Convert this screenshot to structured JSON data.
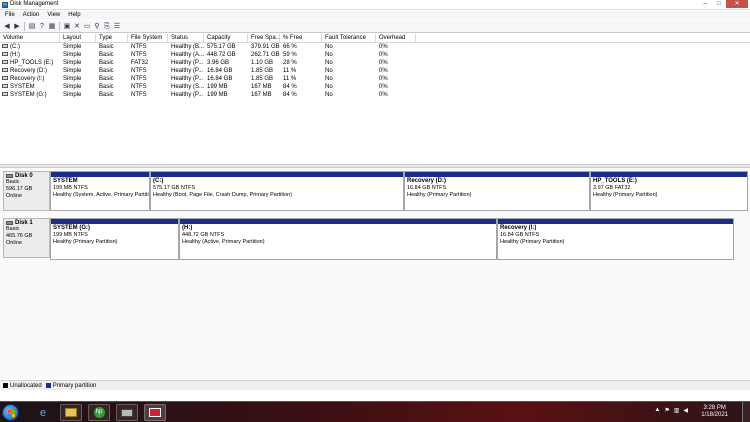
{
  "window": {
    "title": "Disk Management"
  },
  "menu": [
    "File",
    "Action",
    "View",
    "Help"
  ],
  "window_buttons": {
    "minimize": "–",
    "maximize": "□",
    "close": "✕"
  },
  "volume_columns": [
    "Volume",
    "Layout",
    "Type",
    "File System",
    "Status",
    "Capacity",
    "Free Spa...",
    "% Free",
    "Fault Tolerance",
    "Overhead"
  ],
  "volumes": [
    [
      "(C:)",
      "Simple",
      "Basic",
      "NTFS",
      "Healthy (B...",
      "575.17 GB",
      "379.91 GB",
      "66 %",
      "No",
      "0%"
    ],
    [
      "(H:)",
      "Simple",
      "Basic",
      "NTFS",
      "Healthy (A...",
      "448.72 GB",
      "262.71 GB",
      "59 %",
      "No",
      "0%"
    ],
    [
      "HP_TOOLS (E:)",
      "Simple",
      "Basic",
      "FAT32",
      "Healthy (P...",
      "3.96 GB",
      "1.10 GB",
      "28 %",
      "No",
      "0%"
    ],
    [
      "Recovery (D:)",
      "Simple",
      "Basic",
      "NTFS",
      "Healthy (P...",
      "16.84 GB",
      "1.85 GB",
      "11 %",
      "No",
      "0%"
    ],
    [
      "Recovery (I:)",
      "Simple",
      "Basic",
      "NTFS",
      "Healthy (P...",
      "16.84 GB",
      "1.85 GB",
      "11 %",
      "No",
      "0%"
    ],
    [
      "SYSTEM",
      "Simple",
      "Basic",
      "NTFS",
      "Healthy (S...",
      "199 MB",
      "167 MB",
      "84 %",
      "No",
      "0%"
    ],
    [
      "SYSTEM (G:)",
      "Simple",
      "Basic",
      "NTFS",
      "Healthy (P...",
      "199 MB",
      "167 MB",
      "84 %",
      "No",
      "0%"
    ]
  ],
  "disks": [
    {
      "name": "Disk 0",
      "type": "Basic",
      "size": "596.17 GB",
      "status": "Online",
      "partitions": [
        {
          "name": "SYSTEM",
          "size": "199 MB NTFS",
          "status": "Healthy (System, Active, Primary Partiti"
        },
        {
          "name": "(C:)",
          "size": "575.17 GB NTFS",
          "status": "Healthy (Boot, Page File, Crash Dump, Primary Partition)"
        },
        {
          "name": "Recovery (D:)",
          "size": "16.84 GB NTFS",
          "status": "Healthy (Primary Partition)"
        },
        {
          "name": "HP_TOOLS (E:)",
          "size": "3.97 GB FAT32",
          "status": "Healthy (Primary Partition)"
        }
      ]
    },
    {
      "name": "Disk 1",
      "type": "Basic",
      "size": "465.76 GB",
      "status": "Online",
      "partitions": [
        {
          "name": "SYSTEM (G:)",
          "size": "199 MB NTFS",
          "status": "Healthy (Primary Partition)"
        },
        {
          "name": "(H:)",
          "size": "448.72 GB NTFS",
          "status": "Healthy (Active, Primary Partition)"
        },
        {
          "name": "Recovery (I:)",
          "size": "16.84 GB NTFS",
          "status": "Healthy (Primary Partition)"
        }
      ]
    }
  ],
  "legend": [
    {
      "label": "Unallocated",
      "color": "#000000"
    },
    {
      "label": "Primary partition",
      "color": "#1a2c8c"
    }
  ],
  "colors": {
    "partition_bar": "#1a2c8c",
    "taskbar": "#3a0f13",
    "close_button": "#c7504a"
  },
  "taskbar": {
    "apps": [
      "internet-explorer-icon",
      "file-explorer-icon",
      "hp-support-icon",
      "computer-management-icon",
      "disk-management-icon"
    ],
    "clock_time": "3:28 PM",
    "clock_date": "1/18/2021"
  }
}
